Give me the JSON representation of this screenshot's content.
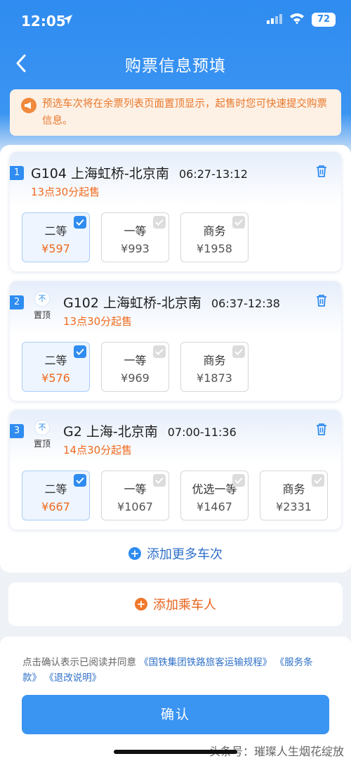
{
  "status_bar": {
    "time": "12:05",
    "battery": "72"
  },
  "header": {
    "title": "购票信息预填"
  },
  "notice": {
    "text": "预选车次将在余票列表页面置顶显示，起售时您可快速提交购票信息。"
  },
  "pin_label": "置顶",
  "pin_icon_char": "不",
  "trains": [
    {
      "index": "1",
      "number": "G104",
      "route": "上海虹桥-北京南",
      "time": "06:27-13:12",
      "sale": "13点30分起售",
      "seats": [
        {
          "name": "二等",
          "price": "¥597",
          "selected": true
        },
        {
          "name": "一等",
          "price": "¥993",
          "selected": false
        },
        {
          "name": "商务",
          "price": "¥1958",
          "selected": false
        }
      ]
    },
    {
      "index": "2",
      "number": "G102",
      "route": "上海虹桥-北京南",
      "time": "06:37-12:38",
      "sale": "13点30分起售",
      "seats": [
        {
          "name": "二等",
          "price": "¥576",
          "selected": true
        },
        {
          "name": "一等",
          "price": "¥969",
          "selected": false
        },
        {
          "name": "商务",
          "price": "¥1873",
          "selected": false
        }
      ]
    },
    {
      "index": "3",
      "number": "G2",
      "route": "上海-北京南",
      "time": "07:00-11:36",
      "sale": "14点30分起售",
      "seats": [
        {
          "name": "二等",
          "price": "¥667",
          "selected": true
        },
        {
          "name": "一等",
          "price": "¥1067",
          "selected": false
        },
        {
          "name": "优选一等",
          "price": "¥1467",
          "selected": false
        },
        {
          "name": "商务",
          "price": "¥2331",
          "selected": false
        }
      ]
    }
  ],
  "add_more_label": "添加更多车次",
  "add_passenger_label": "添加乘车人",
  "agreement": {
    "prefix": "点击确认表示已阅读并同意",
    "link1": "《国铁集团铁路旅客运输规程》",
    "link2": "《服务条款》",
    "link3": "《退改说明》"
  },
  "confirm_label": "确认",
  "watermark": "头条号：璀璨人生烟花绽放",
  "colors": {
    "primary": "#2f8cf0",
    "accent": "#f06a1e",
    "notice_bg": "#fdf1e6"
  }
}
